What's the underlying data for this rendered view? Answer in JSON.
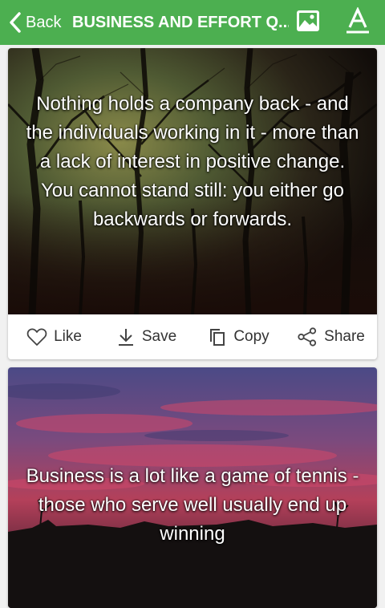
{
  "header": {
    "back_label": "Back",
    "title": "BUSINESS AND EFFORT Q...",
    "background_color": "#4caf50",
    "icons": [
      "chevron-left-icon",
      "image-icon",
      "font-icon"
    ]
  },
  "quotes": [
    {
      "text": "Nothing holds a company back - and the individuals working in it - more than a lack of interest in positive change. You cannot stand still: you either go backwards or forwards."
    },
    {
      "text": "Business is a lot like a game of tennis - those who serve well usually end up winning"
    }
  ],
  "actions": {
    "like_label": "Like",
    "save_label": "Save",
    "copy_label": "Copy",
    "share_label": "Share",
    "icons": [
      "heart-icon",
      "download-icon",
      "copy-icon",
      "share-icon"
    ]
  }
}
